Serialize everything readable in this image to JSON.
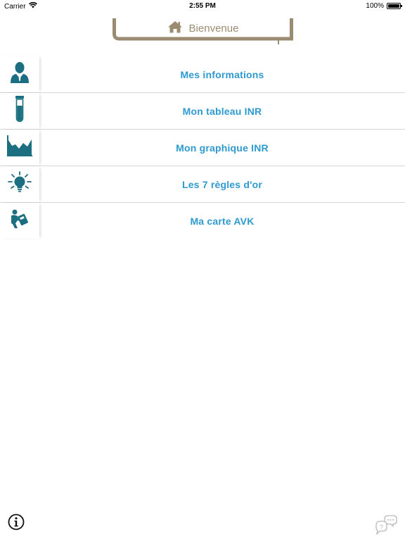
{
  "status_bar": {
    "carrier": "Carrier",
    "time": "2:55 PM",
    "battery": "100%"
  },
  "header": {
    "title": "Bienvenue",
    "icon": "home-icon"
  },
  "menu": {
    "items": [
      {
        "label": "Mes informations",
        "icon": "user-icon"
      },
      {
        "label": "Mon tableau INR",
        "icon": "test-tube-icon"
      },
      {
        "label": "Mon graphique INR",
        "icon": "area-chart-icon"
      },
      {
        "label": "Les 7 règles d'or",
        "icon": "lightbulb-icon"
      },
      {
        "label": "Ma carte AVK",
        "icon": "card-reader-icon"
      }
    ]
  },
  "footer": {
    "info_icon": "info-icon",
    "help_icon": "help-chat-icon"
  },
  "colors": {
    "accent": "#2d9ad0",
    "icon": "#1b6f80",
    "header": "#9b8b70",
    "divider": "#d6d6d6"
  }
}
